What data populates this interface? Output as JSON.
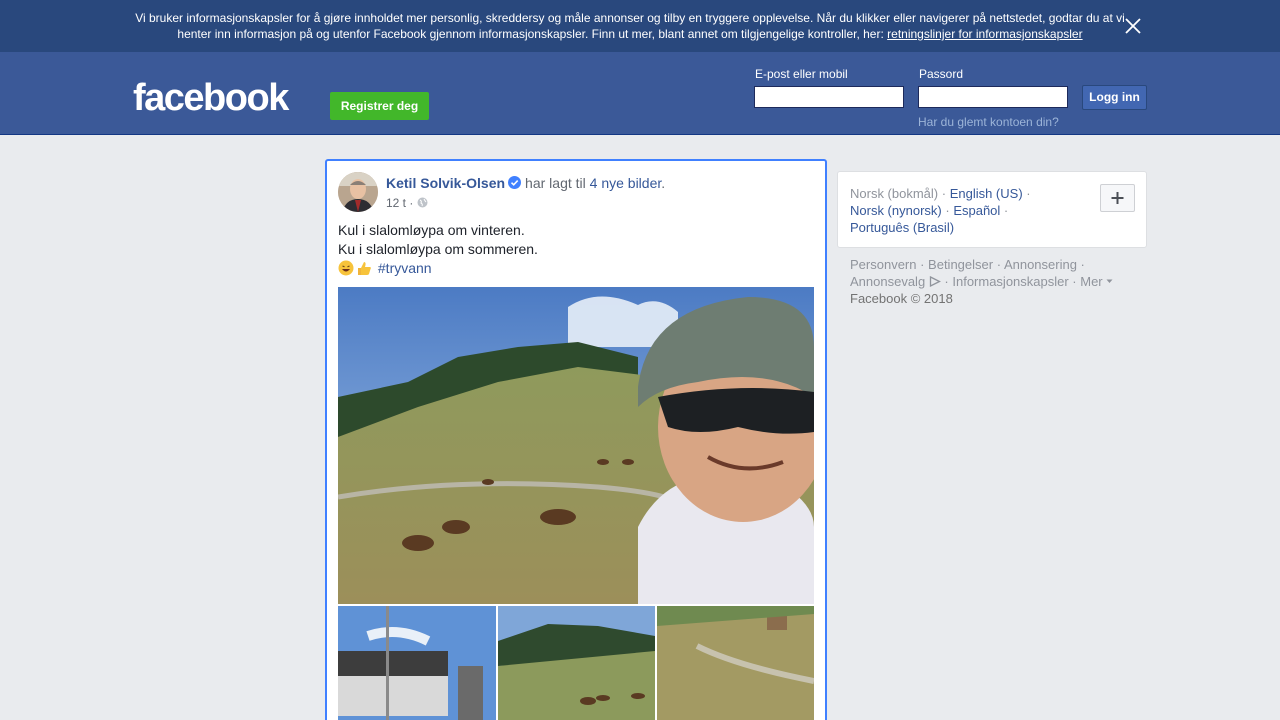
{
  "cookie_banner": {
    "text": "Vi bruker informasjonskapsler for å gjøre innholdet mer personlig, skreddersy og måle annonser og tilby en tryggere opplevelse. Når du klikker eller navigerer på nettstedet, godtar du at vi henter inn informasjon på og utenfor Facebook gjennom informasjonskapsler. Finn ut mer, blant annet om tilgjengelige kontroller, her:",
    "link": "retningslinjer for informasjonskapsler"
  },
  "header": {
    "logo": "facebook",
    "register_label": "Registrer deg",
    "email_label": "E-post eller mobil",
    "password_label": "Passord",
    "login_label": "Logg inn",
    "forgot_label": "Har du glemt kontoen din?"
  },
  "post": {
    "author": "Ketil Solvik-Olsen",
    "action_prefix": "har lagt til",
    "action_link": "4 nye bilder",
    "action_suffix": ".",
    "time": "12 t",
    "meta_separator": " · ",
    "lines": [
      "Kul i slalomløypa om vinteren.",
      "Ku i slalomløypa om sommeren."
    ],
    "hashtag": "#tryvann"
  },
  "languages": {
    "current": "Norsk (bokmål)",
    "options": [
      "English (US)",
      "Norsk (nynorsk)",
      "Español",
      "Português (Brasil)"
    ],
    "separator": " · "
  },
  "footer": {
    "links": [
      "Personvern",
      "Betingelser",
      "Annonsering",
      "Annonsevalg",
      "Informasjonskapsler",
      "Mer"
    ],
    "copyright": "Facebook © 2018"
  },
  "colors": {
    "brand_blue": "#3b5998",
    "banner_blue": "#29487d",
    "register_green": "#42b72a",
    "link_blue": "#365899",
    "focus_border": "#4080ff"
  }
}
